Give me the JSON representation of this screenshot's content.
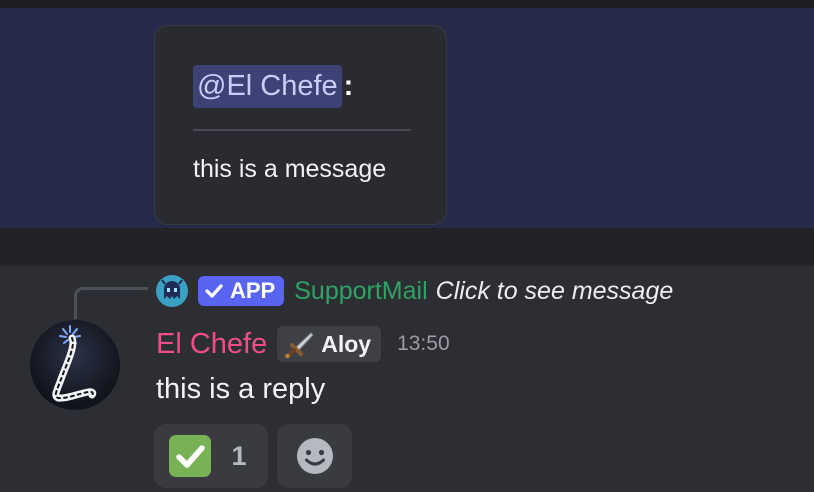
{
  "highlighted_message": {
    "embed": {
      "mention": "@El Chefe",
      "separator": ":",
      "body": "this is a message"
    }
  },
  "reply_reference": {
    "app_badge": "APP",
    "app_badge_icon": "checkmark-icon",
    "app_icon": "ghost-bot-icon",
    "author": "SupportMail",
    "author_color": "#2fa365",
    "text": "Click to see message"
  },
  "message": {
    "author": "El Chefe",
    "author_color": "#f04d86",
    "role": {
      "name": "Aloy",
      "icon": "sword-icon"
    },
    "timestamp": "13:50",
    "content": "this is a reply",
    "avatar_icon": "letter-l-icon"
  },
  "reactions": [
    {
      "emoji": "white-check-mark-icon",
      "count": "1"
    }
  ],
  "add_reaction_icon": "smiley-face-icon",
  "colors": {
    "mention_bg": "#3c4275",
    "highlight_bg": "#262a49",
    "brand": "#5865f2"
  }
}
